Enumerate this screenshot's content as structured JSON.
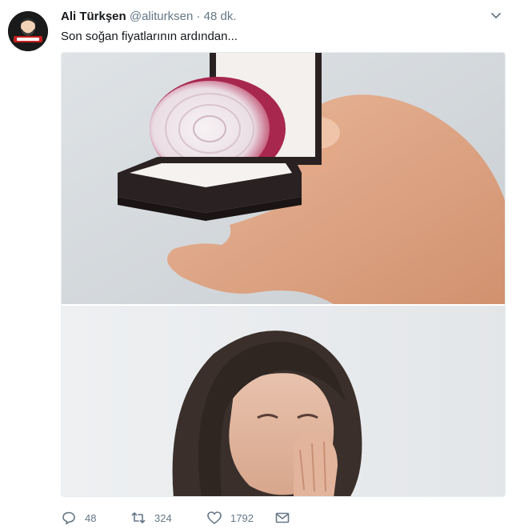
{
  "tweet": {
    "author_name": "Ali Türkşen",
    "author_handle": "@aliturksen",
    "separator": "·",
    "time": "48 dk.",
    "text": "Son soğan fiyatlarının ardından...",
    "media": [
      {
        "description": "hand holding onion half in ring box",
        "icon": "onion-ring-box"
      },
      {
        "description": "crying woman covering mouth",
        "icon": "crying-woman"
      }
    ],
    "actions": {
      "reply_count": "48",
      "retweet_count": "324",
      "like_count": "1792"
    }
  },
  "colors": {
    "text_primary": "#14171a",
    "text_secondary": "#657786",
    "border": "#e6ecf0"
  }
}
